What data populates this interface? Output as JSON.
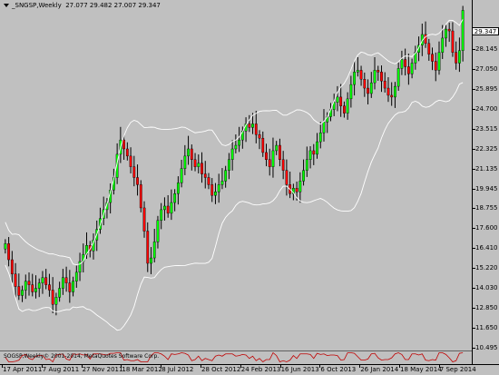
{
  "header": {
    "symbol": "_SNGSP,Weekly",
    "ohlc": "27.077 29.482 27.007 29.347"
  },
  "last_price": "29.347",
  "copyright": "SOGSP,Weekly© 2001-2014, MetaQuotes Software Corp.",
  "colors": {
    "bg": "#c0c0c0",
    "bull": "#00ff00",
    "bear": "#ff0000",
    "wick": "#000000",
    "bands": "#ffffff",
    "indicator": "#c00000"
  },
  "chart_data": {
    "type": "candlestick",
    "title": "",
    "xlabel": "",
    "ylabel": "",
    "ylim": [
      10.475,
      29.93
    ],
    "y_ticks": [
      "29.347",
      "28.145",
      "27.050",
      "25.895",
      "24.700",
      "23.515",
      "22.325",
      "21.135",
      "19.945",
      "18.755",
      "17.600",
      "16.410",
      "15.220",
      "14.030",
      "12.850",
      "11.650",
      "10.495"
    ],
    "x_ticks": [
      "17 Apr 2011",
      "7 Aug 2011",
      "27 Nov 2011",
      "18 Mar 2012",
      "8 Jul 2012",
      "28 Oct 2012",
      "24 Feb 2013",
      "16 Jun 2013",
      "6 Oct 2013",
      "26 Jan 2014",
      "18 May 2014",
      "7 Sep 2014"
    ],
    "close": [
      16.3,
      15.4,
      14.6,
      13.9,
      13.4,
      13.7,
      14.2,
      14.0,
      13.6,
      13.8,
      14.1,
      14.4,
      14.0,
      13.7,
      12.9,
      13.3,
      13.8,
      14.4,
      14.1,
      13.6,
      14.2,
      14.7,
      15.3,
      15.7,
      16.2,
      15.9,
      16.5,
      17.1,
      17.7,
      18.2,
      18.6,
      19.3,
      20.0,
      21.3,
      22.1,
      21.6,
      21.2,
      20.6,
      20.0,
      19.6,
      18.3,
      17.0,
      15.2,
      15.5,
      16.4,
      17.6,
      18.2,
      18.4,
      18.0,
      18.6,
      19.1,
      19.7,
      20.5,
      21.2,
      21.6,
      21.0,
      20.6,
      20.8,
      20.2,
      20.0,
      19.6,
      19.0,
      19.2,
      19.6,
      19.8,
      20.4,
      21.0,
      21.6,
      21.8,
      22.1,
      22.6,
      23.0,
      22.8,
      23.0,
      22.4,
      22.2,
      21.4,
      21.0,
      20.6,
      21.5,
      21.8,
      21.0,
      20.4,
      19.6,
      19.1,
      19.4,
      19.2,
      19.8,
      20.4,
      21.0,
      21.5,
      21.3,
      22.0,
      22.5,
      23.1,
      23.4,
      23.8,
      24.2,
      24.5,
      24.0,
      23.6,
      24.4,
      25.2,
      25.9,
      26.0,
      25.5,
      25.0,
      24.7,
      25.3,
      26.0,
      25.9,
      25.4,
      25.0,
      24.6,
      24.5,
      25.1,
      26.1,
      26.6,
      26.2,
      25.8,
      26.4,
      27.0,
      27.4,
      28.0,
      27.5,
      26.9,
      26.5,
      26.0,
      27.0,
      27.8,
      28.3,
      28.2,
      27.0,
      26.4,
      27.1,
      29.35
    ],
    "bands": {
      "upper_start": 17.6,
      "upper_end": 29.0,
      "lower_start": 12.0,
      "lower_end": 24.9,
      "period": 20,
      "deviations": 2
    },
    "indicator": {
      "name": "",
      "range": [
        -1,
        1
      ]
    }
  }
}
